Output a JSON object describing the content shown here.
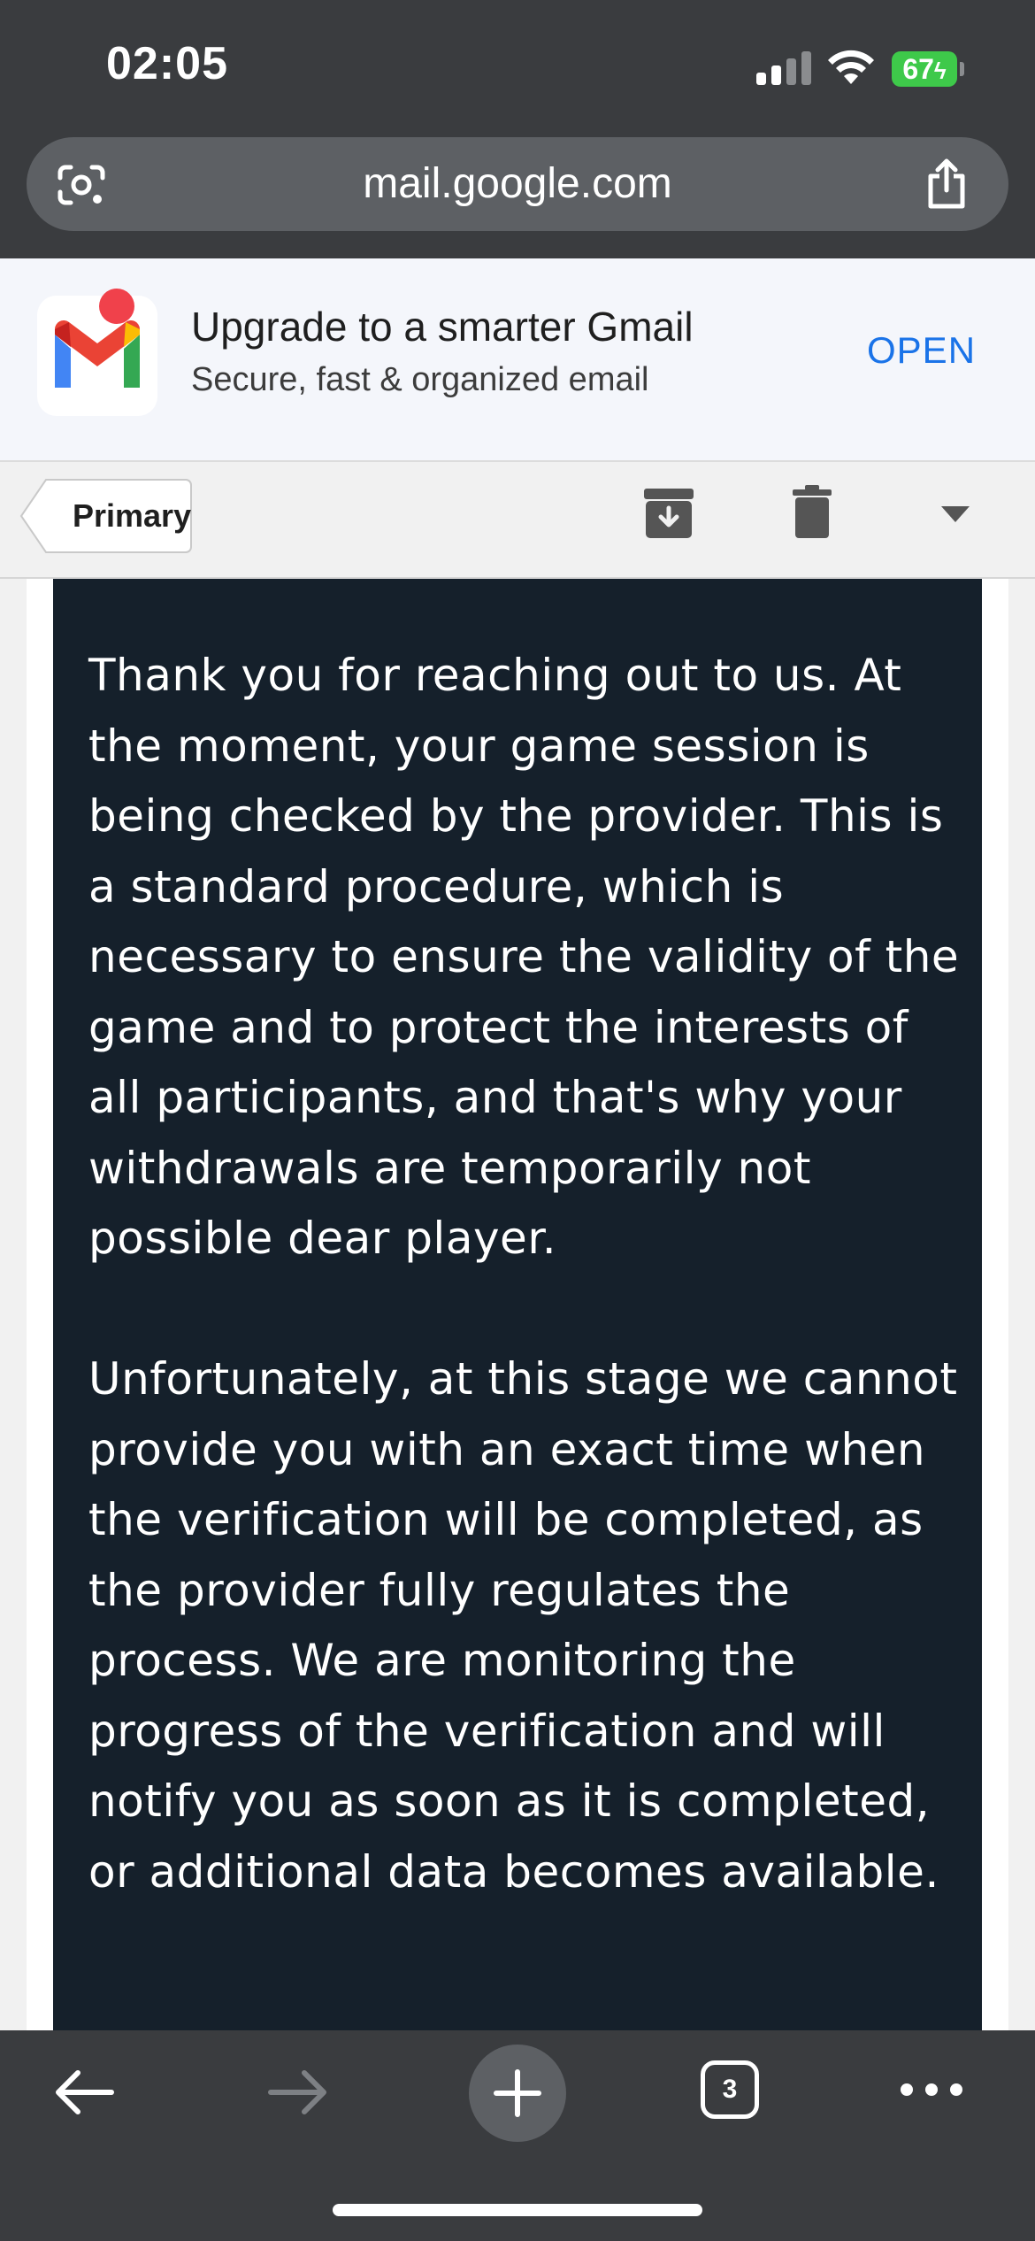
{
  "status_bar": {
    "time": "02:05",
    "battery": "67"
  },
  "browser": {
    "url": "mail.google.com",
    "tab_count": "3"
  },
  "banner": {
    "title": "Upgrade to a smarter Gmail",
    "subtitle": "Secure, fast & organized email",
    "open_label": "OPEN"
  },
  "toolbar": {
    "primary_label": "Primary"
  },
  "email": {
    "paragraph_1": "Thank you for reaching out to us. At the moment, your game session is being checked by the provider. This is a standard procedure, which is necessary to ensure the validity of the game and to protect the interests of all participants, and that's why your withdrawals are temporarily not possible dear player.",
    "paragraph_2": "Unfortunately, at this stage we cannot provide you with an exact time when the verification will be completed, as the provider fully regulates the process. We are monitoring the progress of the verification and will notify you as soon as it is completed, or additional data becomes available."
  },
  "colors": {
    "chrome_bg": "#3a3c3f",
    "url_bar_bg": "#5d6064",
    "battery_green": "#3ec94a",
    "open_blue": "#1a73e8",
    "message_bg": "#15202b"
  },
  "icons": {
    "lens": "google-lens-icon",
    "share": "share-icon",
    "archive": "archive-icon",
    "trash": "trash-icon",
    "dropdown": "chevron-down-icon",
    "back": "back-arrow-icon",
    "forward": "forward-arrow-icon",
    "new_tab": "plus-icon",
    "more": "more-dots-icon"
  }
}
